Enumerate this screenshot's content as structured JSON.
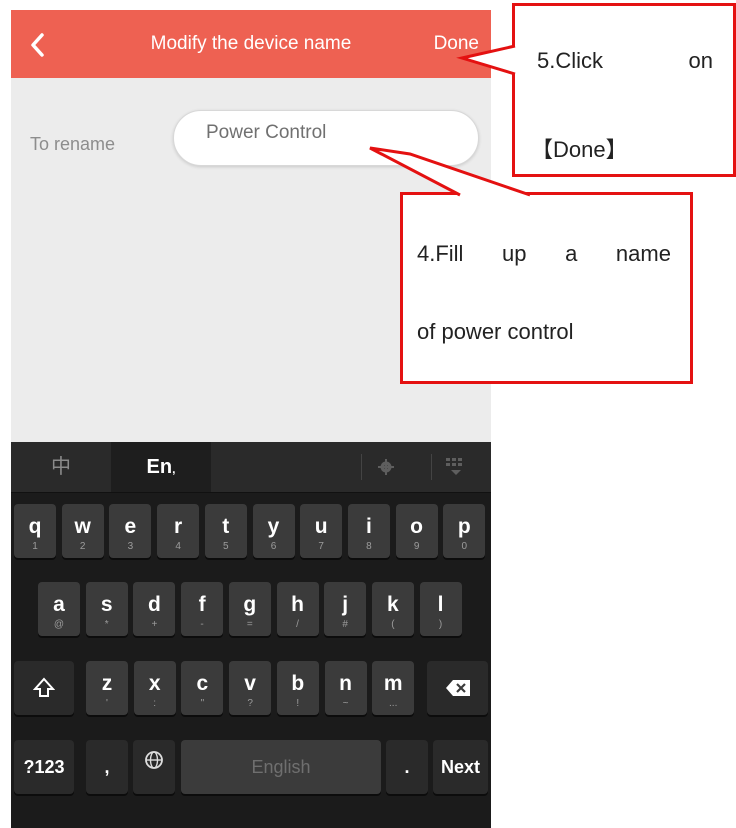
{
  "app": {
    "title": "Modify the device name",
    "done_label": "Done",
    "rename_label": "To rename",
    "name_value": "Power Control"
  },
  "keyboard": {
    "candidates": {
      "zh": "中",
      "en": "En"
    },
    "rows": [
      [
        {
          "main": "q",
          "sub": "1"
        },
        {
          "main": "w",
          "sub": "2"
        },
        {
          "main": "e",
          "sub": "3"
        },
        {
          "main": "r",
          "sub": "4"
        },
        {
          "main": "t",
          "sub": "5"
        },
        {
          "main": "y",
          "sub": "6"
        },
        {
          "main": "u",
          "sub": "7"
        },
        {
          "main": "i",
          "sub": "8"
        },
        {
          "main": "o",
          "sub": "9"
        },
        {
          "main": "p",
          "sub": "0"
        }
      ],
      [
        {
          "main": "a",
          "sub": "@"
        },
        {
          "main": "s",
          "sub": "*"
        },
        {
          "main": "d",
          "sub": "+"
        },
        {
          "main": "f",
          "sub": "-"
        },
        {
          "main": "g",
          "sub": "="
        },
        {
          "main": "h",
          "sub": "/"
        },
        {
          "main": "j",
          "sub": "#"
        },
        {
          "main": "k",
          "sub": "("
        },
        {
          "main": "l",
          "sub": ")"
        }
      ],
      [
        {
          "main": "z",
          "sub": "'"
        },
        {
          "main": "x",
          "sub": ":"
        },
        {
          "main": "c",
          "sub": "\""
        },
        {
          "main": "v",
          "sub": "?"
        },
        {
          "main": "b",
          "sub": "!"
        },
        {
          "main": "n",
          "sub": "~"
        },
        {
          "main": "m",
          "sub": "..."
        }
      ]
    ],
    "sym_label": "?123",
    "comma": ",",
    "space_label": "English",
    "period": ".",
    "next_label": "Next"
  },
  "callouts": {
    "done_word1": "5.Click",
    "done_word2": "on",
    "done_line2": "【Done】",
    "name_words": [
      "4.Fill",
      "up",
      "a",
      "name"
    ],
    "name_line2": "of power control"
  },
  "colors": {
    "topbar": "#ee6152",
    "callout_border": "#e41111",
    "keyboard_bg": "#1b1b1b"
  }
}
